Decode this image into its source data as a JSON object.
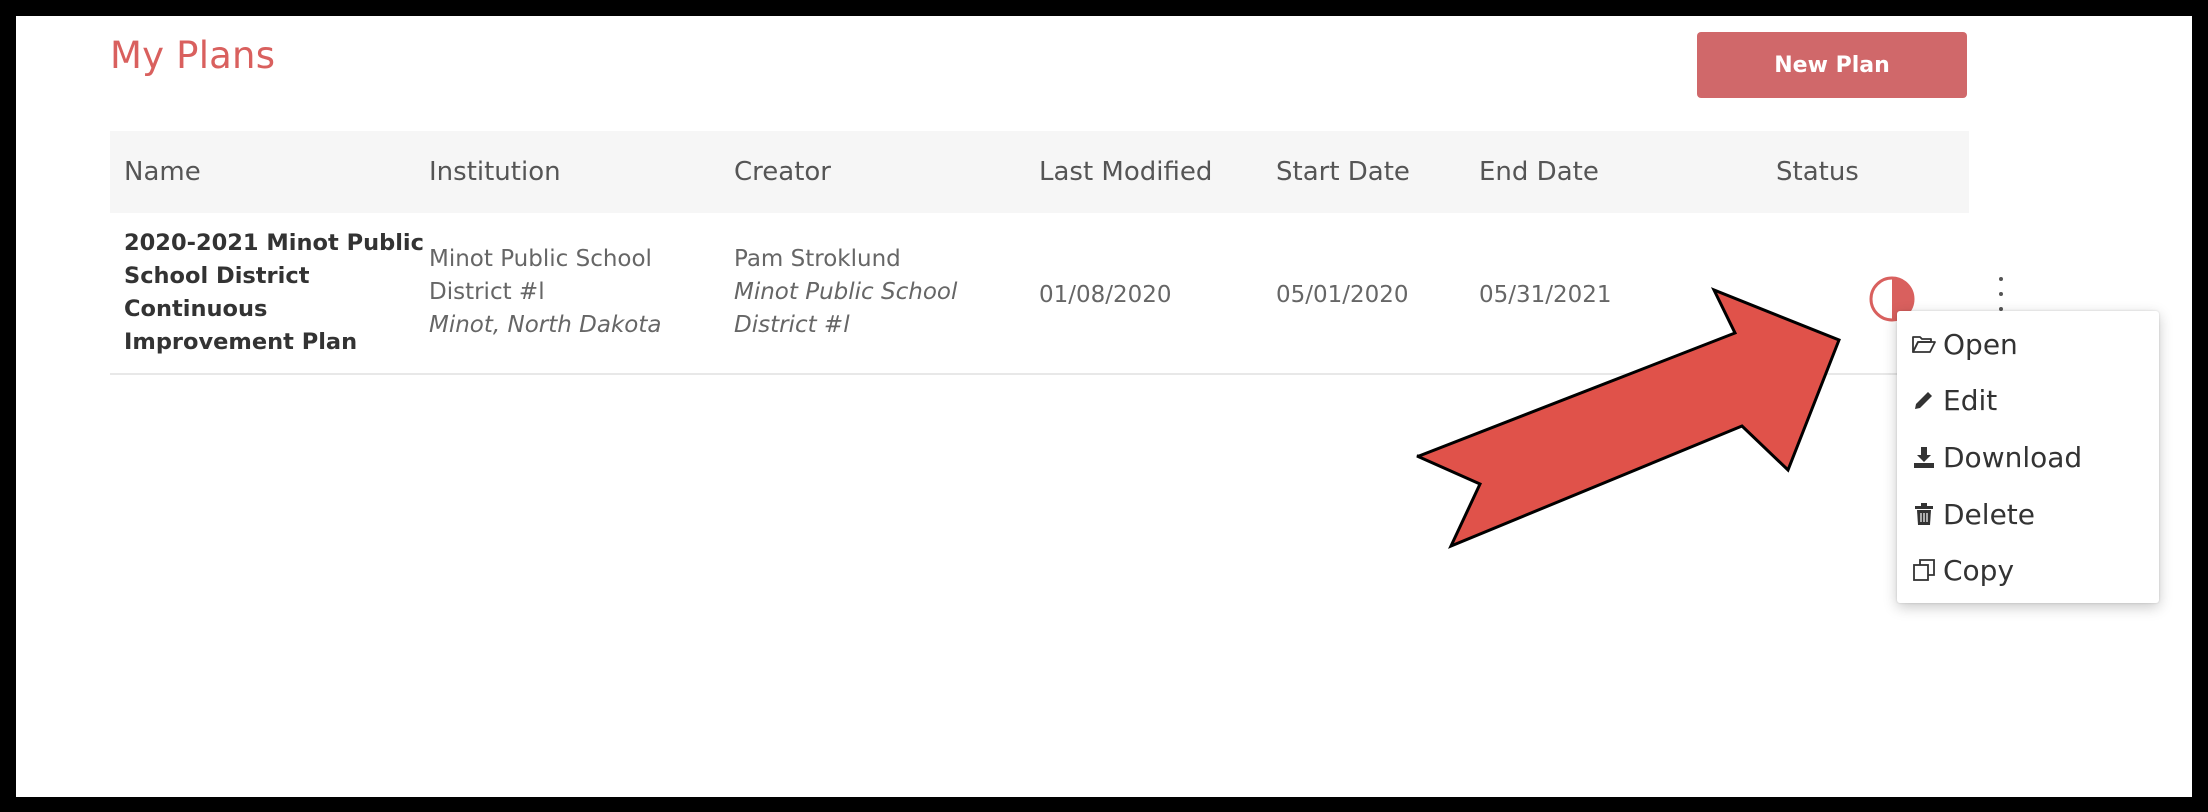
{
  "page": {
    "title": "My Plans",
    "new_plan_label": "New Plan"
  },
  "table": {
    "headers": [
      "Name",
      "Institution",
      "Creator",
      "Last Modified",
      "Start Date",
      "End Date",
      "Status"
    ],
    "rows": [
      {
        "name_lines": [
          "2020-2021 Minot Public",
          "School District",
          "Continuous",
          "Improvement Plan"
        ],
        "institution_lines": [
          "Minot Public School",
          "District #l"
        ],
        "institution_location": "Minot, North Dakota",
        "creator_name": "Pam Stroklund",
        "creator_org_lines": [
          "Minot Public School",
          "District #l"
        ],
        "last_modified": "01/08/2020",
        "start_date": "05/01/2020",
        "end_date": "05/31/2021",
        "status_icon": "half-circle-status-icon"
      }
    ]
  },
  "menu": {
    "items": [
      {
        "label": "Open",
        "icon": "folder-open-icon"
      },
      {
        "label": "Edit",
        "icon": "pencil-icon"
      },
      {
        "label": "Download",
        "icon": "download-icon"
      },
      {
        "label": "Delete",
        "icon": "trash-icon"
      },
      {
        "label": "Copy",
        "icon": "copy-icon"
      }
    ]
  },
  "colors": {
    "accent": "#d9605e",
    "button": "#d0686a",
    "arrow": "#e0524a"
  }
}
